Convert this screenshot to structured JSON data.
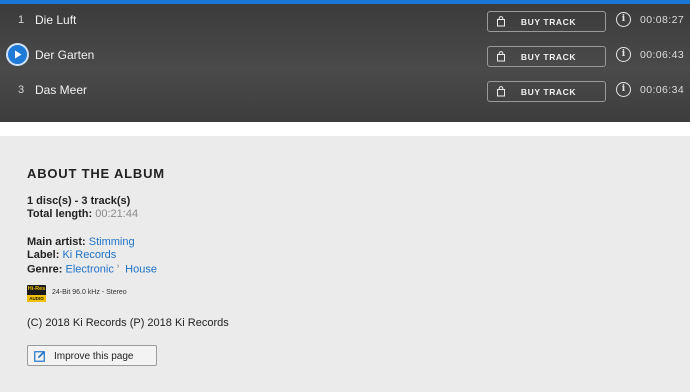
{
  "tracks": [
    {
      "number": "1",
      "title": "Die Luft",
      "duration": "00:08:27",
      "playing": false
    },
    {
      "number": "",
      "title": "Der Garten",
      "duration": "00:06:43",
      "playing": true
    },
    {
      "number": "3",
      "title": "Das Meer",
      "duration": "00:06:34",
      "playing": false
    }
  ],
  "buy_label": "BUY TRACK",
  "info_glyph": "i",
  "about": {
    "title": "ABOUT THE ALBUM",
    "discs_tracks": "1 disc(s) - 3 track(s)",
    "total_length_label": "Total length:",
    "total_length_value": "00:21:44",
    "main_artist_label": "Main artist:",
    "main_artist_value": "Stimming",
    "label_label": "Label:",
    "label_value": "Ki Records",
    "genre_label": "Genre:",
    "genres": [
      "Electronic",
      "House"
    ],
    "genre_separator": "›",
    "hires_badge_top": "Hi-Res",
    "hires_badge_bottom": "AUDIO",
    "quality": "24-Bit 96.0 kHz - Stereo",
    "copyright": "(C) 2018 Ki Records (P) 2018 Ki Records",
    "improve_label": "Improve this page"
  },
  "colors": {
    "accent": "#1e73c8",
    "play_button": "#1f79d6",
    "hires_gold": "#f2c200"
  }
}
